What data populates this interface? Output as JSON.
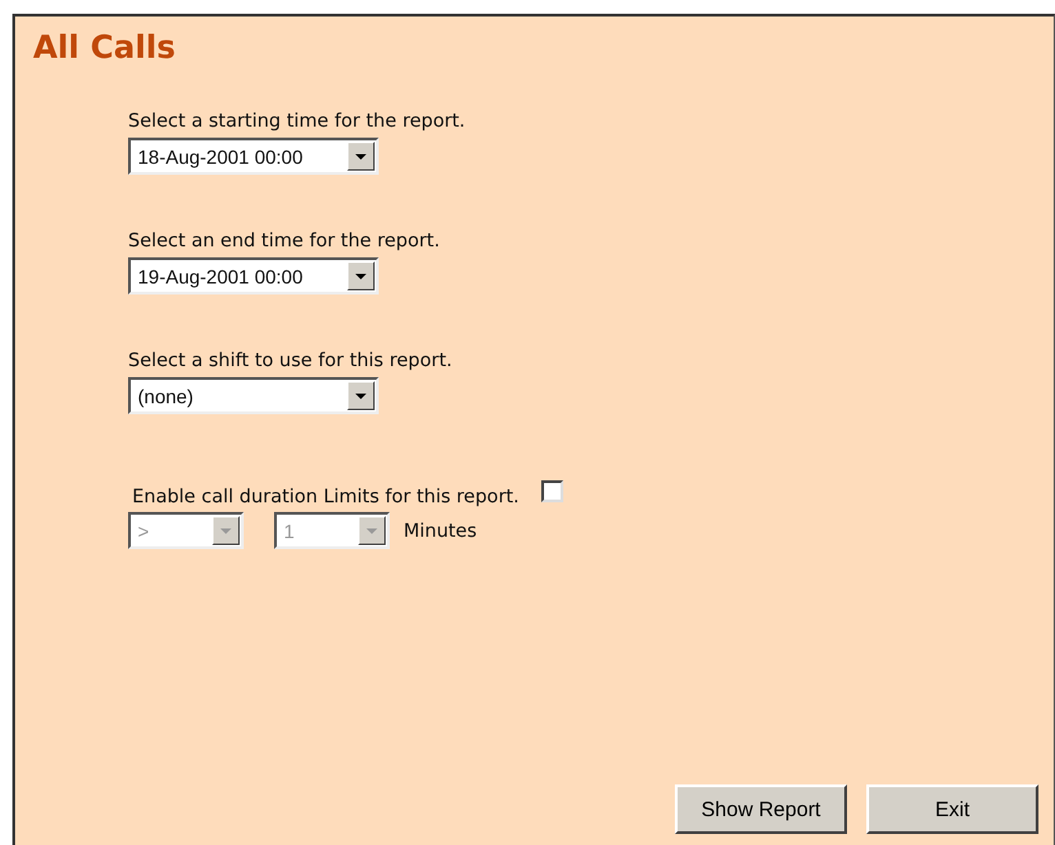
{
  "title": "All Calls",
  "fields": [
    {
      "label": "Select a starting time for the report.",
      "value": "18-Aug-2001 00:00",
      "disabled": false
    },
    {
      "label": "Select an end time for the report.",
      "value": "19-Aug-2001 00:00",
      "disabled": false
    },
    {
      "label": "Select a shift to use for this report.",
      "value": "(none)",
      "disabled": false
    }
  ],
  "limits": {
    "label": "Enable call duration Limits for this report.",
    "checked": false,
    "selects": [
      {
        "value": ">",
        "disabled": true
      },
      {
        "value": "1",
        "disabled": true
      }
    ],
    "unit": "Minutes"
  },
  "buttons": [
    {
      "label": "Show Report"
    },
    {
      "label": "Exit"
    }
  ]
}
